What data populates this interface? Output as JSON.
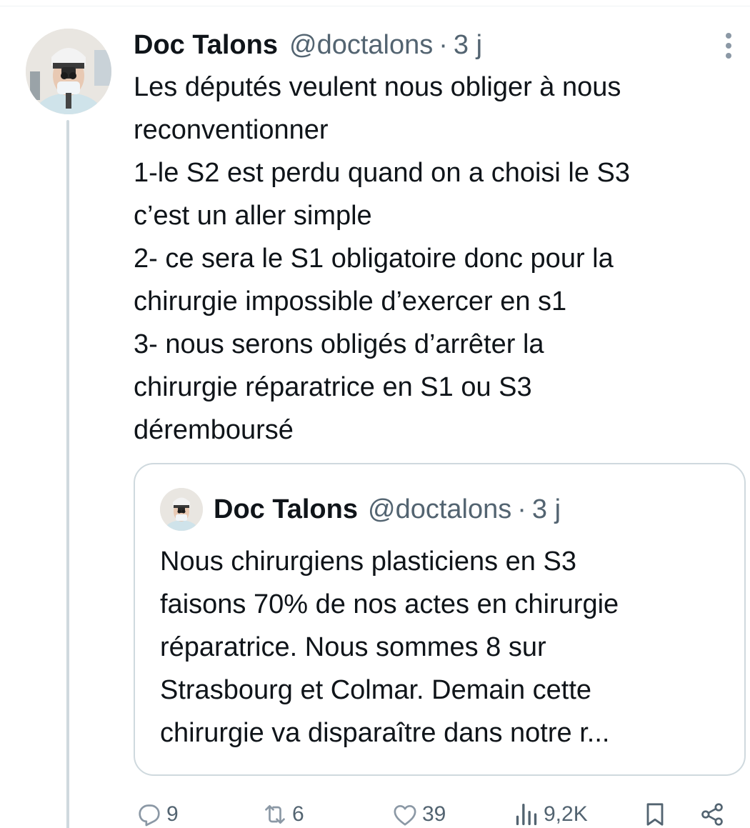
{
  "tweet": {
    "author_name": "Doc Talons",
    "handle": "@doctalons",
    "separator": "·",
    "time": "3 j",
    "text_lines": [
      "Les députés veulent nous obliger à nous",
      "reconventionner",
      "1-le S2 est perdu quand on a choisi le S3",
      "c’est un aller simple",
      "2- ce sera le S1 obligatoire donc pour la",
      "chirurgie impossible d’exercer en s1",
      "3- nous serons obligés d’arrêter la",
      "chirurgie réparatrice en S1 ou S3",
      "déremboursé"
    ]
  },
  "quote": {
    "author_name": "Doc Talons",
    "handle": "@doctalons",
    "separator": "·",
    "time": "3 j",
    "text_lines": [
      "Nous chirurgiens plasticiens en S3",
      "faisons 70% de nos actes en chirurgie",
      "réparatrice. Nous sommes 8 sur",
      "Strasbourg et Colmar. Demain cette",
      "chirurgie va disparaître dans notre r..."
    ]
  },
  "actions": {
    "replies": "9",
    "reposts": "6",
    "likes": "39",
    "views": "9,2K"
  },
  "icons": {
    "more": "more-vertical-icon",
    "reply": "reply-icon",
    "repost": "repost-icon",
    "like": "heart-icon",
    "views": "views-icon",
    "bookmark": "bookmark-icon",
    "share": "share-icon"
  },
  "colors": {
    "text": "#0f1419",
    "secondary": "#536471",
    "border": "#cfd9de"
  }
}
